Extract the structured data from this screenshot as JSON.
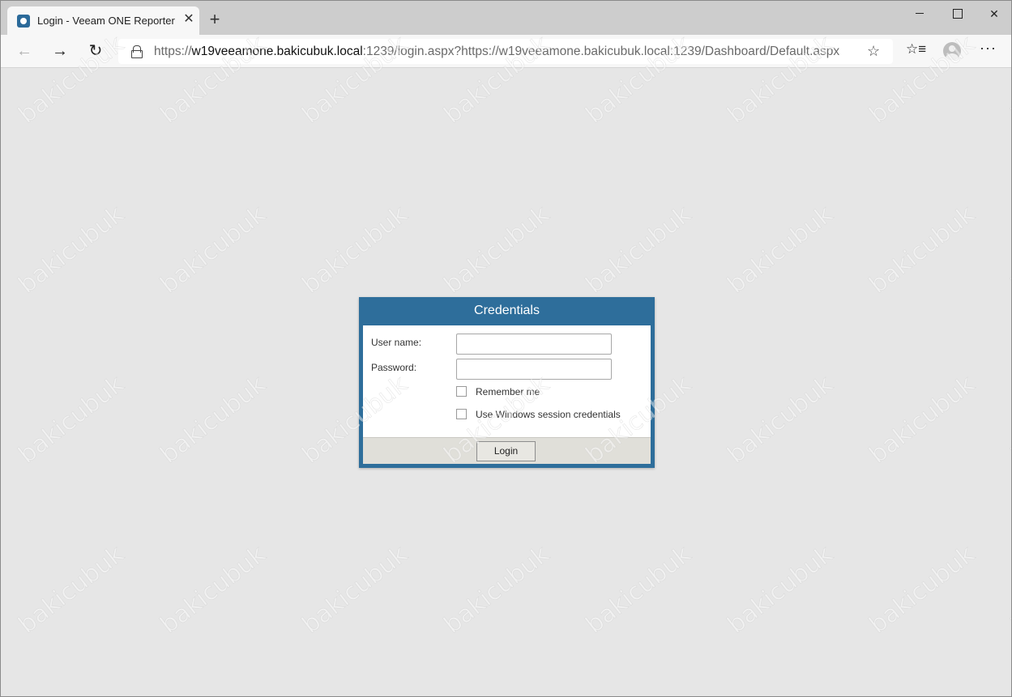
{
  "browser": {
    "tab_title": "Login - Veeam ONE Reporter",
    "tab_close": "✕",
    "new_tab": "+",
    "url_host_prefix": "https://",
    "url_host": "w19veeamone.bakicubuk.local",
    "url_rest": ":1239/login.aspx?https://w19veeamone.bakicubuk.local:1239/Dashboard/Default.aspx",
    "icons": {
      "back": "back-arrow-icon",
      "forward": "forward-arrow-icon",
      "reload": "reload-icon",
      "lock": "lock-icon",
      "favorite": "star-icon",
      "favorites_list": "favorites-icon",
      "profile": "profile-icon",
      "more": "more-icon"
    }
  },
  "dialog": {
    "title": "Credentials",
    "username_label": "User name:",
    "password_label": "Password:",
    "username_value": "",
    "password_value": "",
    "remember_label": "Remember me",
    "windows_label": "Use Windows session credentials",
    "remember_checked": false,
    "windows_checked": false,
    "login_label": "Login",
    "accent_color": "#2e6e9b"
  },
  "watermark": {
    "text": "bakicubuk"
  }
}
